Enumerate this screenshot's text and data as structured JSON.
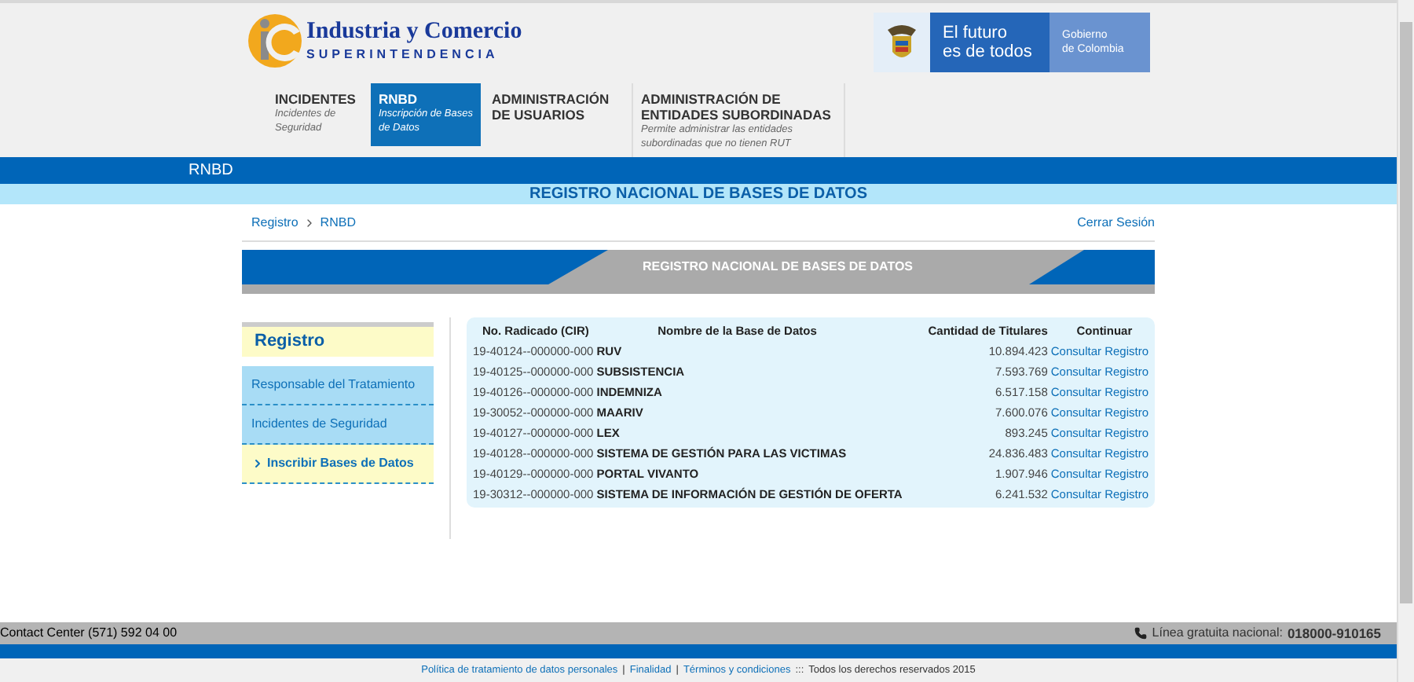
{
  "header": {
    "brand_title": "Industria y Comercio",
    "brand_subtitle": "SUPERINTENDENCIA",
    "gov_slogan_1": "El futuro",
    "gov_slogan_2": "es de todos",
    "gov_name_1": "Gobierno",
    "gov_name_2": "de Colombia"
  },
  "nav": [
    {
      "title": "INCIDENTES",
      "subtitle": "Incidentes de Seguridad",
      "selected": false
    },
    {
      "title": "RNBD",
      "subtitle": "Inscripción de Bases de Datos",
      "selected": true
    },
    {
      "title": "ADMINISTRACIÓN DE USUARIOS",
      "selected": false
    },
    {
      "title": "ADMINISTRACIÓN DE ENTIDADES SUBORDINADAS",
      "subtitle": "Permite administrar las entidades subordinadas que no tienen RUT",
      "selected": false
    }
  ],
  "section_bar": {
    "label": "RNBD"
  },
  "page_title": "REGISTRO NACIONAL DE BASES DE DATOS",
  "breadcrumb": [
    "Registro",
    "RNBD"
  ],
  "logout": "Cerrar Sesión",
  "banner": "REGISTRO NACIONAL DE BASES DE DATOS",
  "sidebar": {
    "title": "Registro",
    "items": [
      {
        "label": "Responsable del Tratamiento",
        "selected": false
      },
      {
        "label": "Incidentes de Seguridad",
        "selected": false
      },
      {
        "label": "Inscribir Bases de Datos",
        "selected": true
      }
    ]
  },
  "table": {
    "columns": [
      "No. Radicado (CIR)",
      "Nombre de la Base de Datos",
      "Cantidad de Titulares",
      "Continuar"
    ],
    "rows": [
      {
        "radicado": "19-40124--000000-000",
        "name": "RUV",
        "count": "10.894.423",
        "action": "Consultar Registro"
      },
      {
        "radicado": "19-40125--000000-000",
        "name": "SUBSISTENCIA",
        "count": "7.593.769",
        "action": "Consultar Registro"
      },
      {
        "radicado": "19-40126--000000-000",
        "name": "INDEMNIZA",
        "count": "6.517.158",
        "action": "Consultar Registro"
      },
      {
        "radicado": "19-30052--000000-000",
        "name": "MAARIV",
        "count": "7.600.076",
        "action": "Consultar Registro"
      },
      {
        "radicado": "19-40127--000000-000",
        "name": "LEX",
        "count": "893.245",
        "action": "Consultar Registro"
      },
      {
        "radicado": "19-40128--000000-000",
        "name": "SISTEMA DE GESTIÓN PARA LAS VICTIMAS",
        "count": "24.836.483",
        "action": "Consultar Registro"
      },
      {
        "radicado": "19-40129--000000-000",
        "name": "PORTAL VIVANTO",
        "count": "1.907.946",
        "action": "Consultar Registro"
      },
      {
        "radicado": "19-30312--000000-000",
        "name": "SISTEMA DE INFORMACIÓN DE GESTIÓN DE OFERTA",
        "count": "6.241.532",
        "action": "Consultar Registro"
      }
    ]
  },
  "contact_bar": {
    "contact": "Contact Center (571) 592 04 00",
    "hotline_label": "Línea gratuita nacional:",
    "hotline_number": "018000-910165"
  },
  "footer": {
    "links": [
      "Política de tratamiento de datos personales",
      "Finalidad",
      "Términos y condiciones"
    ],
    "separator": "|",
    "rights_separator": ":::",
    "rights": "Todos los derechos reservados 2015"
  }
}
